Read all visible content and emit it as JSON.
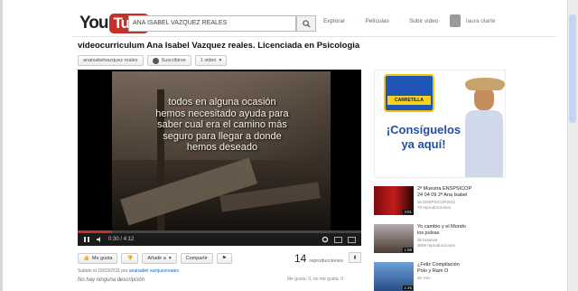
{
  "masthead": {
    "logo_you": "You",
    "logo_tube": "Tube",
    "search_value": "ANA ISABEL VAZQUEZ REALES",
    "nav": [
      "Explorar",
      "Películas",
      "Subir video"
    ],
    "username": "laura olarte"
  },
  "video": {
    "title": "videocurriculum Ana Isabel Vazquez reales. Licenciada en Psicologia",
    "chips": [
      "anaisabelvazquez reales",
      "Suscribirse",
      "1 video"
    ],
    "overlay_lines": "todos en alguna ocasión\nhemos necesitado ayuda para\nsaber cual era el camino más\nseguro para llegar a donde\nhemos deseado",
    "time": "0:30 / 4:12",
    "progress": 0.12
  },
  "actions": {
    "like": "Me gusta",
    "add": "Añadir a",
    "share": "Compartir",
    "flag": "",
    "views": "14",
    "views_label": "reproducciones"
  },
  "meta": {
    "uploaded_prefix": "Subido el 15/03/2011 por",
    "uploader": "anaisabel vazquezreales",
    "description": "No hay ninguna descripción",
    "likes": "Me gusta: 0, no me gusta: 0"
  },
  "ad": {
    "brand": "CARRETILLA",
    "headline": "¡Consíguelos ya aquí!"
  },
  "related": [
    {
      "title": "2ª Muestra ENSPSICOP\n24 04 09 2ª Ana Isabel",
      "channel": "de ENSPSICOP2011",
      "views": "79 reproducciones",
      "duration": "3:01"
    },
    {
      "title": "Yo cambio y el Mundo\nlos pulsas",
      "channel": "de brasrwa",
      "views": "3909 reproducciones",
      "duration": "1:08"
    },
    {
      "title": "¿Feliz Compilación\nPolo y Ram O",
      "channel": "de Yolo",
      "views": "",
      "duration": "2:25"
    }
  ]
}
